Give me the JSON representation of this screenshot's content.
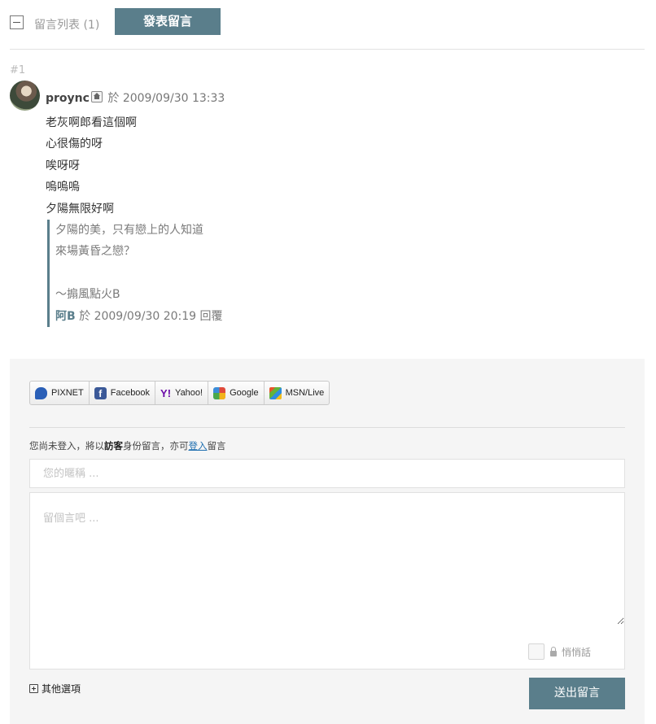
{
  "toolbar": {
    "list_label": "留言列表 (1)",
    "post_button": "發表留言"
  },
  "comment": {
    "number": "#1",
    "author": "proync",
    "meta_text": "於 2009/09/30 13:33",
    "lines": [
      "老灰啊郎看這個啊",
      "心很傷的呀",
      "唉呀呀",
      "嗚嗚嗚",
      "夕陽無限好啊"
    ],
    "reply": {
      "lines": [
        "夕陽的美，只有戀上的人知道",
        "來場黃昏之戀？",
        "",
        "～搧風點火B"
      ],
      "author": "阿B",
      "meta_text": "於 2009/09/30 20:19 回覆"
    }
  },
  "login_providers": [
    {
      "label": "PIXNET",
      "icon": "pixnet-icon"
    },
    {
      "label": "Facebook",
      "icon": "facebook-icon"
    },
    {
      "label": "Yahoo!",
      "icon": "yahoo-icon"
    },
    {
      "label": "Google",
      "icon": "google-icon"
    },
    {
      "label": "MSN/Live",
      "icon": "msn-icon"
    }
  ],
  "form": {
    "notice_prefix": "您尚未登入，將以",
    "notice_guest": "訪客",
    "notice_middle": "身份留言，亦可",
    "notice_login": "登入",
    "notice_suffix": "留言",
    "name_placeholder": "您的暱稱 ...",
    "message_placeholder": "留個言吧 ...",
    "private_label": "悄悄話",
    "more_options": "其他選項",
    "submit": "送出留言"
  },
  "colors": {
    "accent": "#5a7e8b",
    "panel_bg": "#f5f5f5"
  }
}
